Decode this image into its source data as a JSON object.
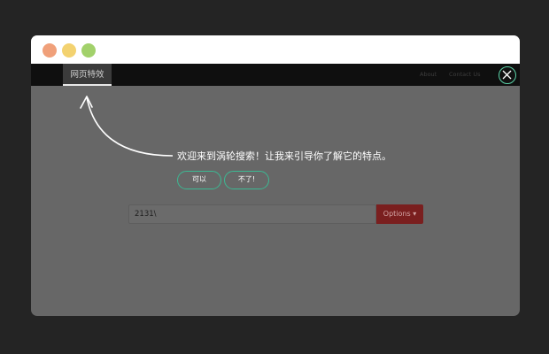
{
  "navbar": {
    "active_tab": "网页特效",
    "links": [
      "About",
      "Contact Us"
    ]
  },
  "guide": {
    "message": "欢迎来到涡轮搜索！让我来引导你了解它的特点。",
    "yes_label": "可以",
    "no_label": "不了!"
  },
  "search": {
    "value": "2131\\",
    "options_label": "Options ▾"
  },
  "colors": {
    "background": "#242424",
    "overlay": "#676767",
    "accent": "#3cb993",
    "options_button": "#7a1f1f",
    "traffic_red": "#f0a07a",
    "traffic_yellow": "#f3d270",
    "traffic_green": "#a2d16b"
  },
  "icons": {
    "close": "close-icon",
    "arrow": "guide-arrow"
  }
}
